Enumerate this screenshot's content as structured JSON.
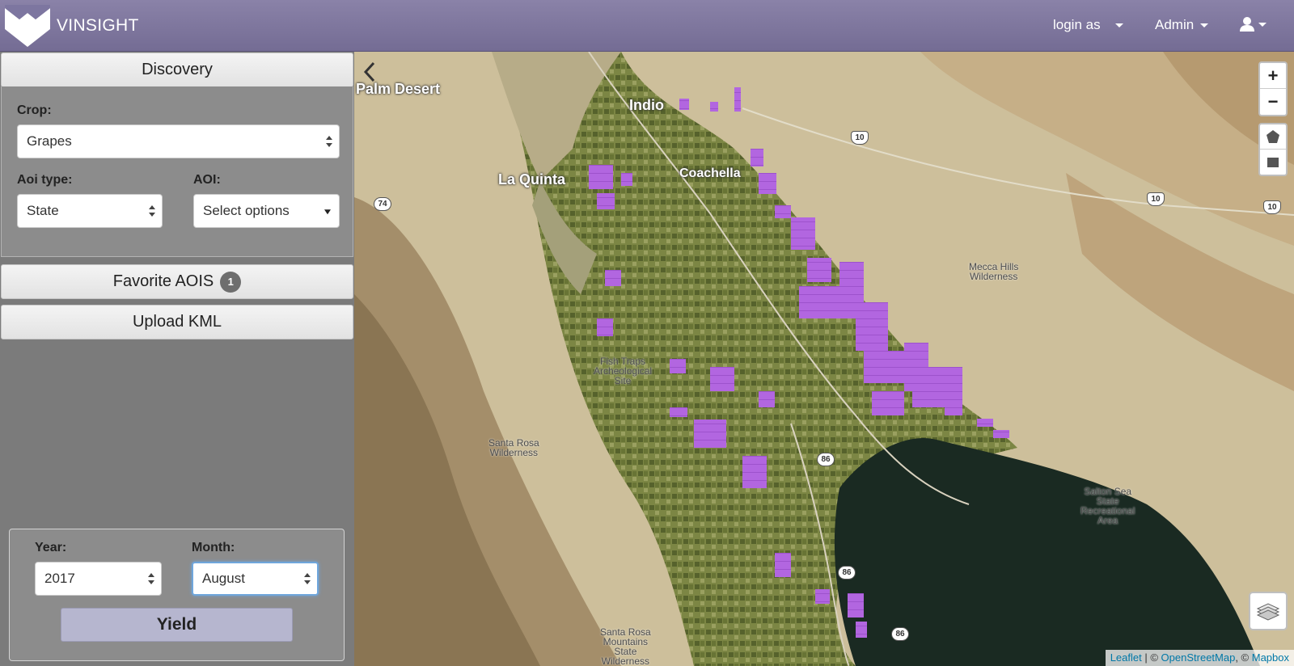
{
  "app": {
    "brand": "VINSIGHT"
  },
  "nav": {
    "login_as": "login as",
    "admin": "Admin"
  },
  "discovery": {
    "title": "Discovery",
    "crop_label": "Crop:",
    "crop_value": "Grapes",
    "aoi_type_label": "Aoi type:",
    "aoi_type_value": "State",
    "aoi_label": "AOI:",
    "aoi_value": "Select options"
  },
  "favorites": {
    "title": "Favorite AOIS",
    "count": "1"
  },
  "upload": {
    "title": "Upload KML"
  },
  "timeframe": {
    "year_label": "Year:",
    "year_value": "2017",
    "month_label": "Month:",
    "month_value": "August",
    "yield_label": "Yield"
  },
  "map": {
    "places": [
      "Palm Desert",
      "Indio",
      "La Quinta",
      "Coachella"
    ],
    "areas": [
      "Mecca Hills\nWilderness",
      "Fish Traps\nArcheological\nSite",
      "Santa Rosa\nWilderness",
      "Salton Sea\nState\nRecreational\nArea",
      "Santa Rosa\nMountains\nState\nWilderness"
    ],
    "roads": [
      "10",
      "10",
      "10",
      "74",
      "86",
      "86",
      "86"
    ],
    "zoom_in": "+",
    "zoom_out": "−",
    "attribution": {
      "leaflet": "Leaflet",
      "sep1": " | © ",
      "osm": "OpenStreetMap",
      "sep2": ", © ",
      "mapbox": "Mapbox"
    },
    "colors": {
      "vineyard": "#b266e0",
      "farmland": "#6f7a38",
      "desert": "#cdbf9b",
      "water": "#1a2a22"
    }
  }
}
